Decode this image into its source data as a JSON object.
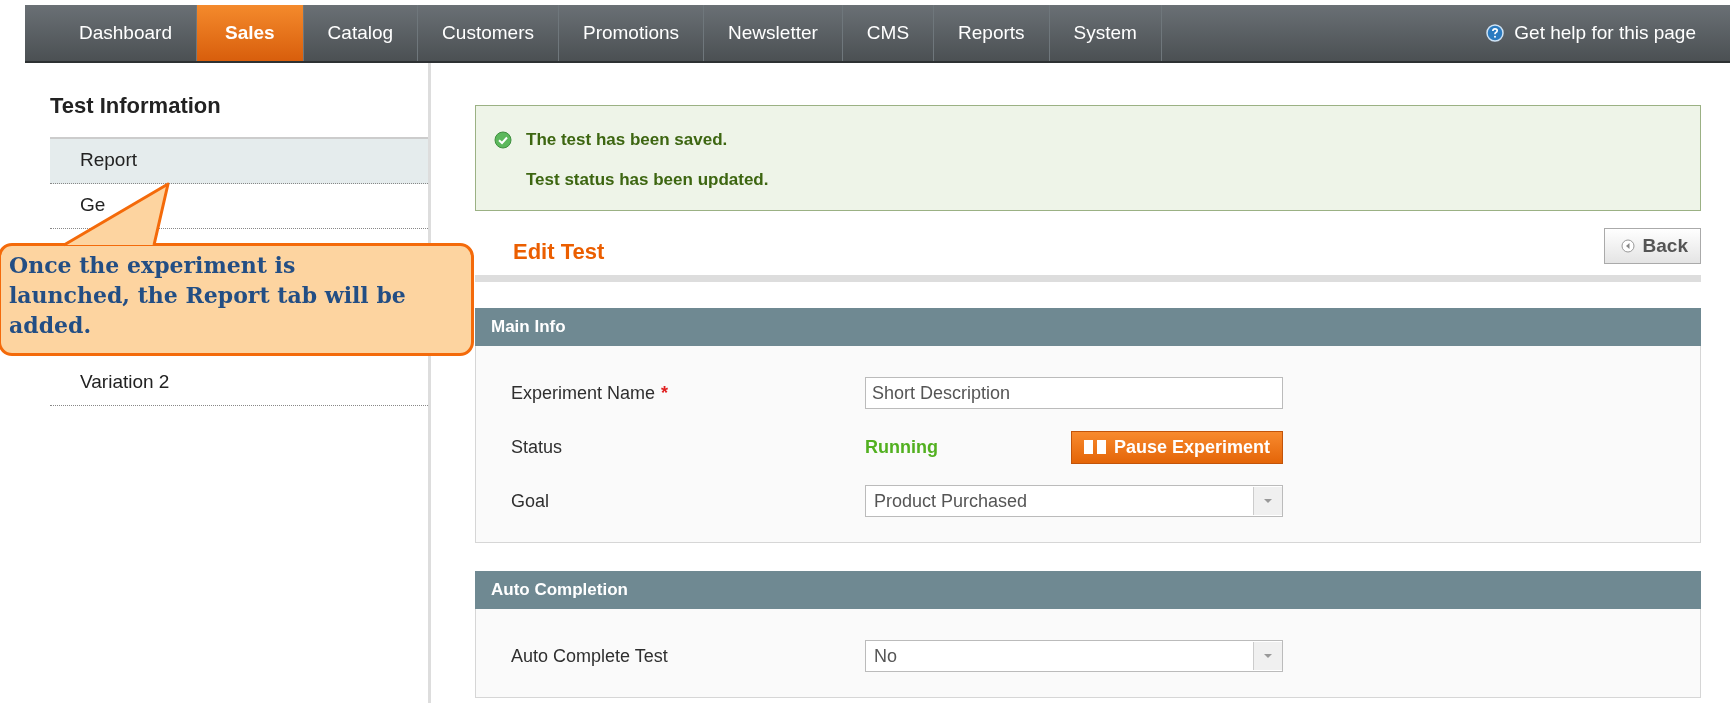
{
  "nav": {
    "items": [
      {
        "label": "Dashboard",
        "selected": false
      },
      {
        "label": "Sales",
        "selected": true
      },
      {
        "label": "Catalog",
        "selected": false
      },
      {
        "label": "Customers",
        "selected": false
      },
      {
        "label": "Promotions",
        "selected": false
      },
      {
        "label": "Newsletter",
        "selected": false
      },
      {
        "label": "CMS",
        "selected": false
      },
      {
        "label": "Reports",
        "selected": false
      },
      {
        "label": "System",
        "selected": false
      }
    ],
    "help": "Get help for this page"
  },
  "sidebar": {
    "title": "Test Information",
    "items": [
      {
        "label": "Report",
        "selected": true
      },
      {
        "label": "Ge",
        "selected": false
      }
    ],
    "after_callout": [
      {
        "label": "Variation 2",
        "selected": false
      }
    ]
  },
  "callout": "Once the experiment is launched, the Report tab will be added.",
  "messages": [
    "The test has been saved.",
    "Test status has been updated."
  ],
  "page_title": "Edit Test",
  "back_button": "Back",
  "sections": [
    {
      "title": "Main Info",
      "fields": [
        {
          "kind": "text",
          "label": "Experiment Name",
          "required_mark": "*",
          "value": "Short Description"
        },
        {
          "kind": "status",
          "label": "Status",
          "value": "Running",
          "button": "Pause Experiment"
        },
        {
          "kind": "select",
          "label": "Goal",
          "value": "Product Purchased"
        }
      ]
    },
    {
      "title": "Auto Completion",
      "fields": [
        {
          "kind": "select",
          "label": "Auto Complete Test",
          "value": "No"
        }
      ]
    }
  ]
}
